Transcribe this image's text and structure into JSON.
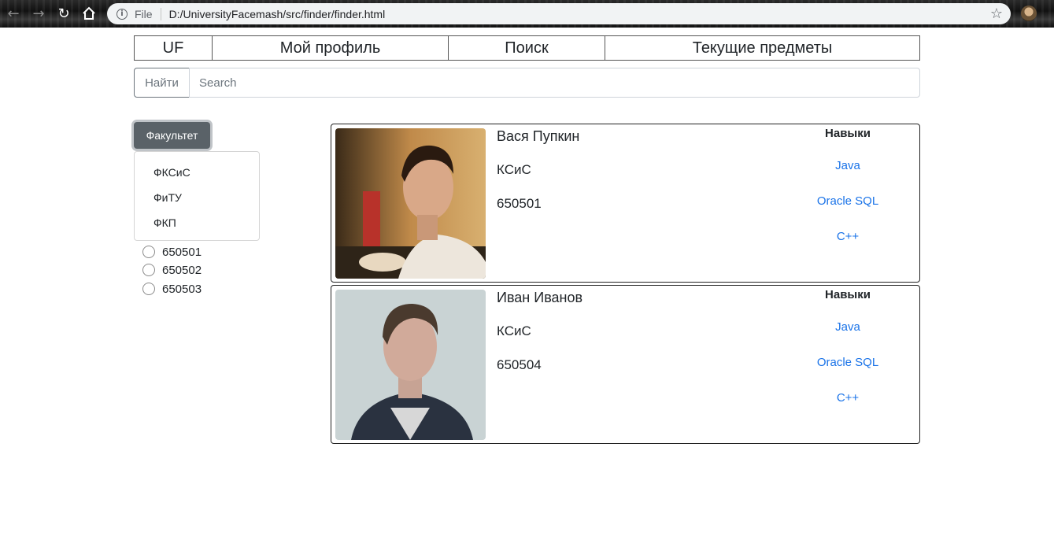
{
  "browser": {
    "scheme": "File",
    "url": "D:/UniversityFacemash/src/finder/finder.html"
  },
  "topnav": {
    "brand": "UF",
    "profile": "Мой профиль",
    "search": "Поиск",
    "subjects": "Текущие предметы"
  },
  "search": {
    "button_label": "Найти",
    "placeholder": "Search"
  },
  "filter": {
    "faculty_button": "Факультет",
    "faculties": [
      "ФКСиС",
      "ФиТУ",
      "ФКП"
    ],
    "groups": [
      "650501",
      "650502",
      "650503"
    ]
  },
  "results": [
    {
      "name": "Вася Пупкин",
      "department": "КСиС",
      "group": "650501",
      "skills_title": "Навыки",
      "skills": [
        "Java",
        "Oracle SQL",
        "C++"
      ]
    },
    {
      "name": "Иван Иванов",
      "department": "КСиС",
      "group": "650504",
      "skills_title": "Навыки",
      "skills": [
        "Java",
        "Oracle SQL",
        "C++"
      ]
    }
  ],
  "colors": {
    "link": "#1a73e8",
    "faculty_button": "#5a6268"
  }
}
